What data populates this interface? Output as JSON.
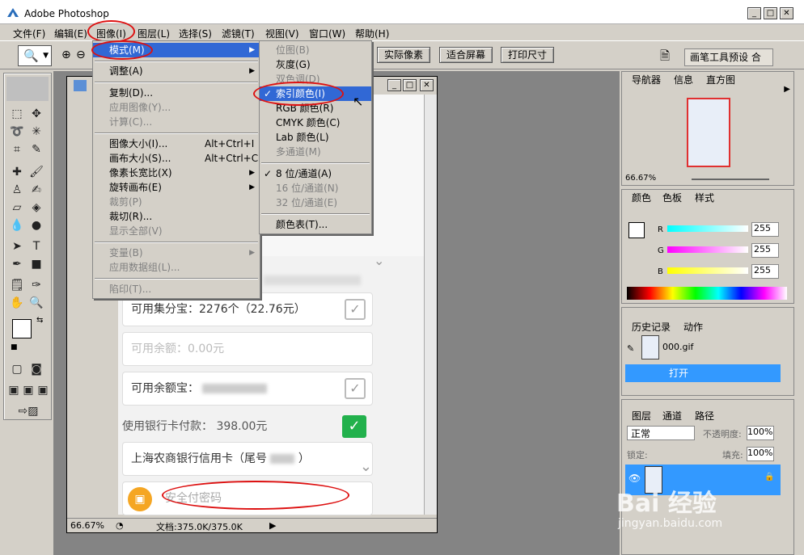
{
  "app": {
    "title": "Adobe Photoshop"
  },
  "menubar": {
    "items": [
      "文件(F)",
      "编辑(E)",
      "图像(I)",
      "图层(L)",
      "选择(S)",
      "滤镜(T)",
      "视图(V)",
      "窗口(W)",
      "帮助(H)"
    ]
  },
  "options": {
    "btn_actual": "实际像素",
    "btn_fit": "适合屏幕",
    "btn_print": "打印尺寸",
    "brush_preset_tab": "画笔工具预设 合"
  },
  "image_menu": {
    "mode": "模式(M)",
    "adjust": "调整(A)",
    "duplicate": "复制(D)...",
    "apply_image": "应用图像(Y)...",
    "calculations": "计算(C)...",
    "image_size": "图像大小(I)...",
    "image_size_sc": "Alt+Ctrl+I",
    "canvas_size": "画布大小(S)...",
    "canvas_size_sc": "Alt+Ctrl+C",
    "pixel_aspect": "像素长宽比(X)",
    "rotate_canvas": "旋转画布(E)",
    "crop": "裁剪(P)",
    "trim": "裁切(R)...",
    "reveal_all": "显示全部(V)",
    "variables": "变量(B)",
    "apply_data_set": "应用数据组(L)...",
    "trap": "陷印(T)..."
  },
  "mode_menu": {
    "bitmap": "位图(B)",
    "grayscale": "灰度(G)",
    "duotone": "双色调(D)",
    "indexed": "索引颜色(I)",
    "rgb": "RGB 颜色(R)",
    "cmyk": "CMYK 颜色(C)",
    "lab": "Lab 颜色(L)",
    "multichannel": "多通道(M)",
    "bit8": "8 位/通道(A)",
    "bit16": "16 位/通道(N)",
    "bit32": "32 位/通道(E)",
    "color_table": "颜色表(T)...",
    "check": "✓"
  },
  "document": {
    "rows": [
      "可用集分宝：2276个（22.76元）",
      "可用余额：0.00元",
      "可用余额宝：",
      "使用银行卡付款：  398.00元",
      "上海农商银行信用卡（尾号",
      "安全付密码"
    ],
    "zoom": "66.67%",
    "doc_info": "文档:375.0K/375.0K"
  },
  "navigator": {
    "tabs": [
      "导航器",
      "信息",
      "直方图"
    ],
    "zoom": "66.67%"
  },
  "color_panel": {
    "tabs": [
      "颜色",
      "色板",
      "样式"
    ],
    "channels": [
      {
        "label": "R",
        "value": "255"
      },
      {
        "label": "G",
        "value": "255"
      },
      {
        "label": "B",
        "value": "255"
      }
    ]
  },
  "history_panel": {
    "tabs": [
      "历史记录",
      "动作"
    ],
    "snapshot": "000.gif",
    "step": "打开"
  },
  "layers_panel": {
    "tabs": [
      "图层",
      "通道",
      "路径"
    ],
    "blend": "正常",
    "opacity_label": "不透明度:",
    "opacity": "100%",
    "lock_label": "锁定:",
    "fill_label": "填充:",
    "fill": "100%"
  },
  "watermark": {
    "brand": "Bai 经验",
    "url": "jingyan.baidu.com"
  },
  "colors": {
    "menu_highlight": "#3168d5",
    "annotation_red": "#dd1111",
    "panel_bg": "#d4d0c8",
    "layer_selected": "#3399ff",
    "checkbox_green": "#22b14c"
  }
}
